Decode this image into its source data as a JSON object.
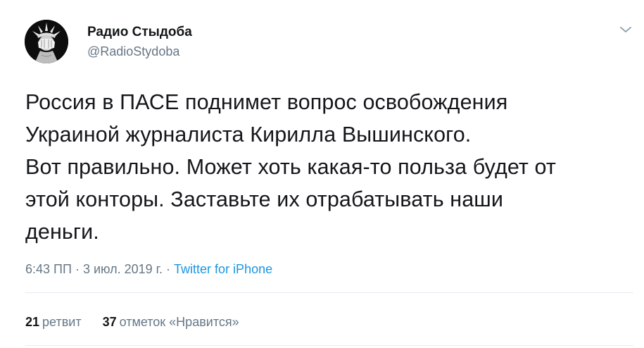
{
  "user": {
    "display_name": "Радио Стыдоба",
    "handle": "@RadioStydoba"
  },
  "tweet": {
    "text": "Россия в ПАСЕ поднимет вопрос освобождения\nУкраиной журналиста Кирилла Вышинского.\nВот правильно. Может хоть какая-то польза будет от\nэтой конторы. Заставьте их отрабатывать наши\nденьги.",
    "time": "6:43 ПП",
    "separator": "·",
    "date": "3 июл. 2019 г.",
    "source": "Twitter for iPhone"
  },
  "stats": {
    "retweets_count": "21",
    "retweets_label": "ретвит",
    "likes_count": "37",
    "likes_label": "отметок «Нравится»"
  },
  "colors": {
    "text": "#14171a",
    "secondary": "#657786",
    "link": "#1b95e0",
    "divider": "#e6ecf0"
  },
  "icons": {
    "caret": "chevron-down-icon",
    "avatar": "statue-of-liberty-facepalm-avatar"
  }
}
